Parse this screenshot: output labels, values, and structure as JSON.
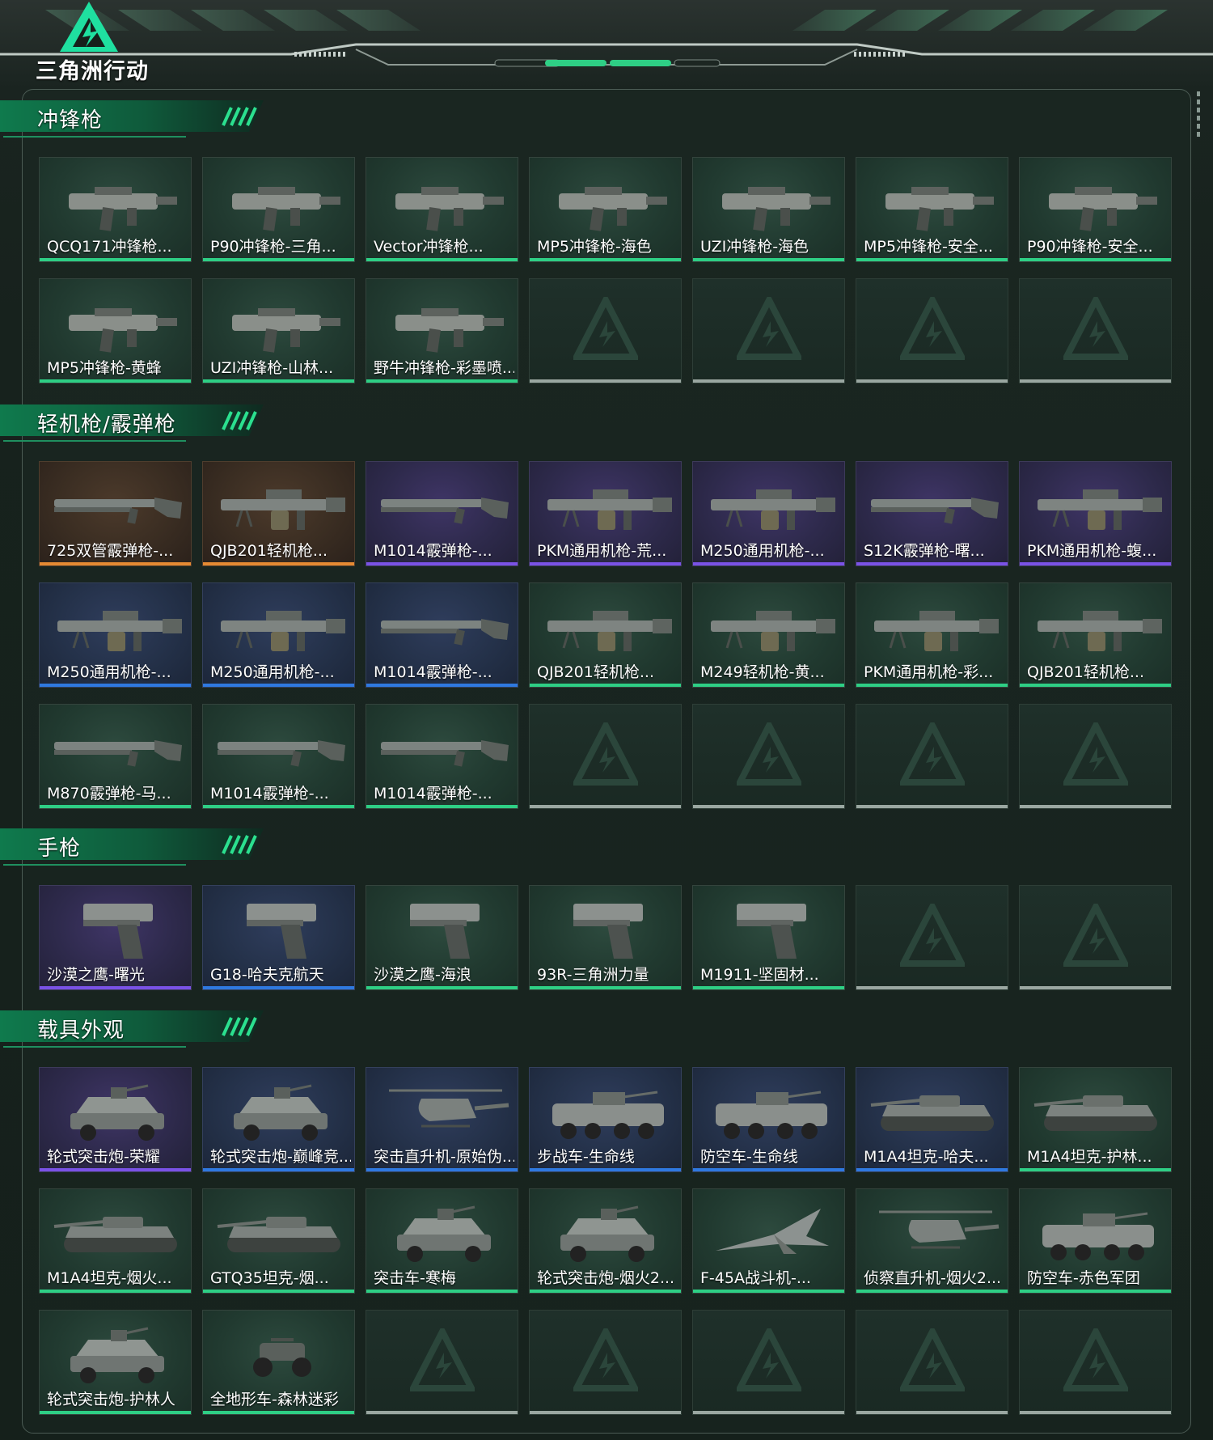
{
  "game_title": "三角洲行动",
  "rarity_colors": {
    "green": "#2ecf85",
    "purple": "#7a52e6",
    "orange": "#e58a33",
    "blue": "#2f79e0",
    "empty": "#9aa7a1"
  },
  "sections": [
    {
      "title": "冲锋枪",
      "items": [
        {
          "name": "QCQ171冲锋枪...",
          "rarity": "green",
          "icon": "smg-icon"
        },
        {
          "name": "P90冲锋枪-三角...",
          "rarity": "green",
          "icon": "smg-icon"
        },
        {
          "name": "Vector冲锋枪...",
          "rarity": "green",
          "icon": "smg-icon"
        },
        {
          "name": "MP5冲锋枪-海色",
          "rarity": "green",
          "icon": "smg-icon"
        },
        {
          "name": "UZI冲锋枪-海色",
          "rarity": "green",
          "icon": "smg-icon"
        },
        {
          "name": "MP5冲锋枪-安全...",
          "rarity": "green",
          "icon": "smg-icon"
        },
        {
          "name": "P90冲锋枪-安全...",
          "rarity": "green",
          "icon": "smg-icon"
        },
        {
          "name": "MP5冲锋枪-黄蜂",
          "rarity": "green",
          "icon": "smg-icon"
        },
        {
          "name": "UZI冲锋枪-山林...",
          "rarity": "green",
          "icon": "smg-icon"
        },
        {
          "name": "野牛冲锋枪-彩墨喷...",
          "rarity": "green",
          "icon": "smg-icon"
        },
        {
          "empty": true
        },
        {
          "empty": true
        },
        {
          "empty": true
        },
        {
          "empty": true
        }
      ]
    },
    {
      "title": "轻机枪/霰弹枪",
      "items": [
        {
          "name": "725双管霰弹枪-...",
          "rarity": "orange",
          "icon": "shotgun-icon"
        },
        {
          "name": "QJB201轻机枪...",
          "rarity": "orange",
          "icon": "lmg-icon"
        },
        {
          "name": "M1014霰弹枪-...",
          "rarity": "purple",
          "icon": "shotgun-icon"
        },
        {
          "name": "PKM通用机枪-荒...",
          "rarity": "purple",
          "icon": "lmg-icon"
        },
        {
          "name": "M250通用机枪-...",
          "rarity": "purple",
          "icon": "lmg-icon"
        },
        {
          "name": "S12K霰弹枪-曙...",
          "rarity": "purple",
          "icon": "shotgun-icon"
        },
        {
          "name": "PKM通用机枪-蝮...",
          "rarity": "purple",
          "icon": "lmg-icon"
        },
        {
          "name": "M250通用机枪-...",
          "rarity": "blue",
          "icon": "lmg-icon"
        },
        {
          "name": "M250通用机枪-...",
          "rarity": "blue",
          "icon": "lmg-icon"
        },
        {
          "name": "M1014霰弹枪-...",
          "rarity": "blue",
          "icon": "shotgun-icon"
        },
        {
          "name": "QJB201轻机枪...",
          "rarity": "green",
          "icon": "lmg-icon"
        },
        {
          "name": "M249轻机枪-黄...",
          "rarity": "green",
          "icon": "lmg-icon"
        },
        {
          "name": "PKM通用机枪-彩...",
          "rarity": "green",
          "icon": "lmg-icon"
        },
        {
          "name": "QJB201轻机枪...",
          "rarity": "green",
          "icon": "lmg-icon"
        },
        {
          "name": "M870霰弹枪-马...",
          "rarity": "green",
          "icon": "shotgun-icon"
        },
        {
          "name": "M1014霰弹枪-...",
          "rarity": "green",
          "icon": "shotgun-icon"
        },
        {
          "name": "M1014霰弹枪-...",
          "rarity": "green",
          "icon": "shotgun-icon"
        },
        {
          "empty": true
        },
        {
          "empty": true
        },
        {
          "empty": true
        },
        {
          "empty": true
        }
      ]
    },
    {
      "title": "手枪",
      "items": [
        {
          "name": "沙漠之鹰-曙光",
          "rarity": "purple",
          "icon": "pistol-icon"
        },
        {
          "name": "G18-哈夫克航天",
          "rarity": "blue",
          "icon": "pistol-icon"
        },
        {
          "name": "沙漠之鹰-海浪",
          "rarity": "green",
          "icon": "pistol-icon"
        },
        {
          "name": "93R-三角洲力量",
          "rarity": "green",
          "icon": "pistol-icon"
        },
        {
          "name": "M1911-坚固材...",
          "rarity": "green",
          "icon": "pistol-icon"
        },
        {
          "empty": true
        },
        {
          "empty": true
        }
      ]
    },
    {
      "title": "载具外观",
      "items": [
        {
          "name": "轮式突击炮-荣耀",
          "rarity": "purple",
          "icon": "armored-car-icon"
        },
        {
          "name": "轮式突击炮-巅峰竞...",
          "rarity": "blue",
          "icon": "armored-car-icon"
        },
        {
          "name": "突击直升机-原始伪...",
          "rarity": "blue",
          "icon": "helicopter-icon"
        },
        {
          "name": "步战车-生命线",
          "rarity": "blue",
          "icon": "ifv-icon"
        },
        {
          "name": "防空车-生命线",
          "rarity": "blue",
          "icon": "ifv-icon"
        },
        {
          "name": "M1A4坦克-哈夫...",
          "rarity": "blue",
          "icon": "tank-icon"
        },
        {
          "name": "M1A4坦克-护林...",
          "rarity": "green",
          "icon": "tank-icon"
        },
        {
          "name": "M1A4坦克-烟火...",
          "rarity": "green",
          "icon": "tank-icon"
        },
        {
          "name": "GTQ35坦克-烟...",
          "rarity": "green",
          "icon": "tank-icon"
        },
        {
          "name": "突击车-寒梅",
          "rarity": "green",
          "icon": "armored-car-icon"
        },
        {
          "name": "轮式突击炮-烟火2...",
          "rarity": "green",
          "icon": "armored-car-icon"
        },
        {
          "name": "F-45A战斗机-...",
          "rarity": "green",
          "icon": "fighter-jet-icon"
        },
        {
          "name": "侦察直升机-烟火2...",
          "rarity": "green",
          "icon": "helicopter-icon"
        },
        {
          "name": "防空车-赤色军团",
          "rarity": "green",
          "icon": "ifv-icon"
        },
        {
          "name": "轮式突击炮-护林人",
          "rarity": "green",
          "icon": "armored-car-icon"
        },
        {
          "name": "全地形车-森林迷彩",
          "rarity": "green",
          "icon": "atv-icon"
        },
        {
          "empty": true
        },
        {
          "empty": true
        },
        {
          "empty": true
        },
        {
          "empty": true
        },
        {
          "empty": true
        }
      ]
    }
  ]
}
